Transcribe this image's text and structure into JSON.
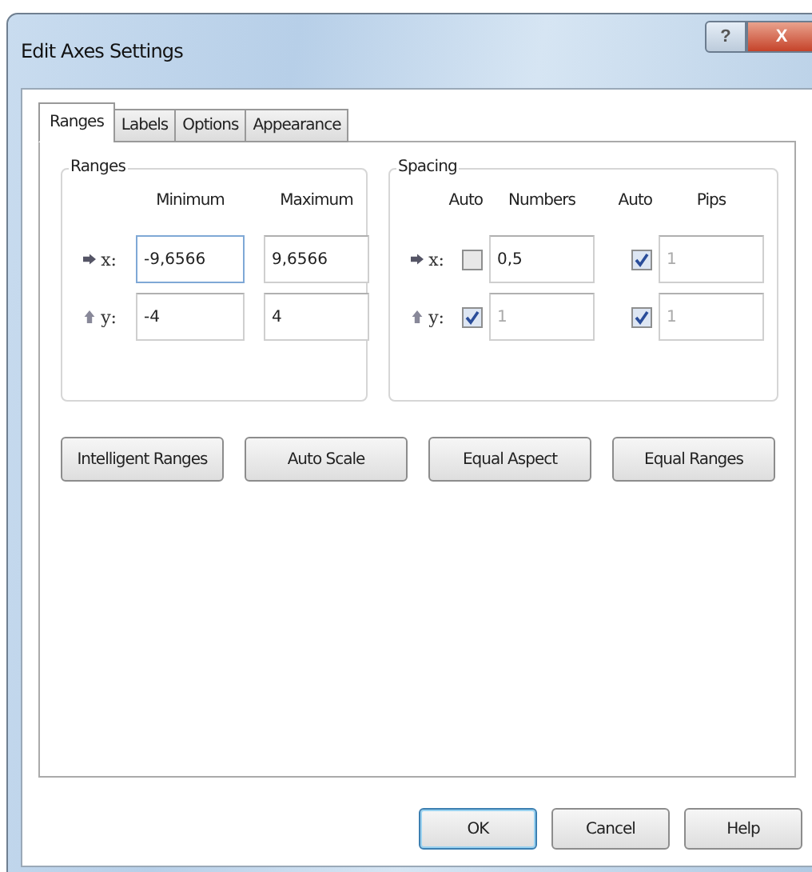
{
  "window": {
    "title": "Edit Axes Settings",
    "title_buttons": [
      {
        "kind": "help",
        "label": "?"
      },
      {
        "kind": "close",
        "label": "X"
      }
    ]
  },
  "tabs": [
    {
      "label": "Ranges",
      "selected": true
    },
    {
      "label": "Labels",
      "selected": false
    },
    {
      "label": "Options",
      "selected": false
    },
    {
      "label": "Appearance",
      "selected": false
    }
  ],
  "ranges": {
    "title": "Ranges",
    "columns": [
      "Minimum",
      "Maximum"
    ],
    "rows": [
      {
        "axis": "x:",
        "kind": "right",
        "minimum": {
          "value": "-9,6566",
          "focused": true
        },
        "maximum": {
          "value": "9,6566",
          "focused": false
        }
      },
      {
        "axis": "y:",
        "kind": "up",
        "minimum": {
          "value": "-4",
          "focused": false
        },
        "maximum": {
          "value": "4",
          "focused": false
        }
      }
    ]
  },
  "spacing": {
    "title": "Spacing",
    "columns": [
      "Auto",
      "Numbers",
      "Auto",
      "Pips"
    ],
    "rows": [
      {
        "axis": "x:",
        "kind": "right",
        "numbers_auto": false,
        "numbers": {
          "value": "0,5",
          "disabled": false
        },
        "pips_auto": true,
        "pips": {
          "value": "1",
          "disabled": true
        }
      },
      {
        "axis": "y:",
        "kind": "up",
        "numbers_auto": true,
        "numbers": {
          "value": "1",
          "disabled": true
        },
        "pips_auto": true,
        "pips": {
          "value": "1",
          "disabled": true
        }
      }
    ]
  },
  "actions": [
    "Intelligent Ranges",
    "Auto Scale",
    "Equal Aspect",
    "Equal Ranges"
  ],
  "footer_buttons": [
    {
      "label": "OK",
      "default": true
    },
    {
      "label": "Cancel",
      "default": false
    },
    {
      "label": "Help",
      "default": false
    }
  ]
}
